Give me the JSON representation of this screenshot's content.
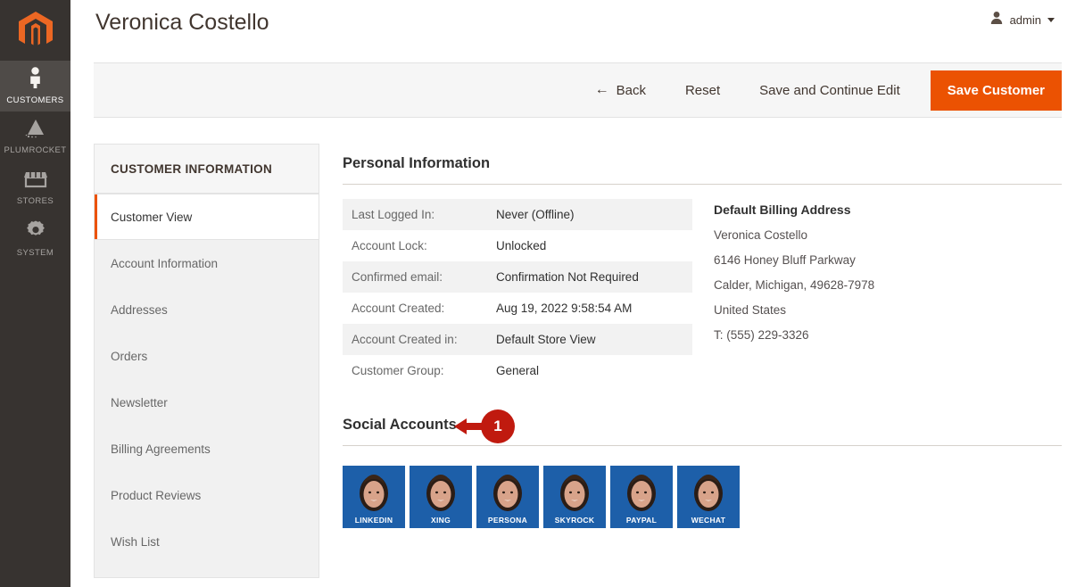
{
  "leftnav": {
    "logo_icon": "magento-logo-icon",
    "logo_color": "#ec6723",
    "items": [
      {
        "label": "CUSTOMERS",
        "icon": "person-icon",
        "active": true
      },
      {
        "label": "PLUMROCKET",
        "icon": "rocket-icon",
        "active": false
      },
      {
        "label": "STORES",
        "icon": "storefront-icon",
        "active": false
      },
      {
        "label": "SYSTEM",
        "icon": "gear-icon",
        "active": false
      }
    ]
  },
  "header": {
    "title": "Veronica Costello",
    "admin_label": "admin",
    "admin_icon": "user-avatar-icon",
    "caret_icon": "chevron-down-icon"
  },
  "toolbar": {
    "back_label": "Back",
    "back_icon": "arrow-left-icon",
    "reset_label": "Reset",
    "save_continue_label": "Save and Continue Edit",
    "save_customer_label": "Save Customer",
    "primary_color": "#eb5202"
  },
  "customer_sidebar": {
    "title": "CUSTOMER INFORMATION",
    "items": [
      {
        "label": "Customer View",
        "active": true
      },
      {
        "label": "Account Information",
        "active": false
      },
      {
        "label": "Addresses",
        "active": false
      },
      {
        "label": "Orders",
        "active": false
      },
      {
        "label": "Newsletter",
        "active": false
      },
      {
        "label": "Billing Agreements",
        "active": false
      },
      {
        "label": "Product Reviews",
        "active": false
      },
      {
        "label": "Wish List",
        "active": false
      }
    ]
  },
  "personal_information": {
    "section_title": "Personal Information",
    "rows": [
      {
        "label": "Last Logged In:",
        "value": "Never (Offline)"
      },
      {
        "label": "Account Lock:",
        "value": "Unlocked"
      },
      {
        "label": "Confirmed email:",
        "value": "Confirmation Not Required"
      },
      {
        "label": "Account Created:",
        "value": "Aug 19, 2022 9:58:54 AM"
      },
      {
        "label": "Account Created in:",
        "value": "Default Store View"
      },
      {
        "label": "Customer Group:",
        "value": "General"
      }
    ]
  },
  "billing_address": {
    "title": "Default Billing Address",
    "lines": [
      "Veronica Costello",
      "6146 Honey Bluff Parkway",
      "Calder, Michigan, 49628-7978",
      "United States",
      "T: (555) 229-3326"
    ]
  },
  "social_accounts": {
    "section_title": "Social Accounts",
    "callout_number": "1",
    "callout_color": "#c01a0f",
    "tile_color": "#1d5fa9",
    "tiles": [
      {
        "label": "LINKEDIN"
      },
      {
        "label": "XING"
      },
      {
        "label": "PERSONA"
      },
      {
        "label": "SKYROCK"
      },
      {
        "label": "PAYPAL"
      },
      {
        "label": "WECHAT"
      }
    ]
  }
}
